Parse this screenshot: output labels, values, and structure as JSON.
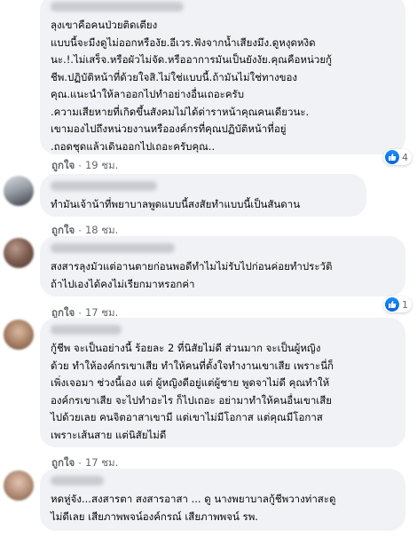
{
  "like_label": "ถูกใจ",
  "dot": "·",
  "comments": [
    {
      "text": "ลุงเขาคือคนป่วยติดเตียง\nแบบนี้จะมีงดูไม่ออกหรืองัย.อีเวร.ฟังจากน้ำเสียงมึง.ดูหงุดหงิด\nนะ.!.ไม่เสร็จ.หรือผัวไม่จัด.หรืออาการมันเป็นยังงัย.คุณคือหน่วยกู้\nชีพ.ปฏิบัติหน้าที่ด้วยใจสิ.ไม่ใช่แบบนี้.ถ้ามันไม่ใช่ทางของ\nคุณ.แนะนำให้ลาออกไปทำอย่างอื่นเถอะครับ\n.ความเสียหายที่เกิดขึ้นสังคมไม่ได้ด่าราหน้าคุณคนเดียวนะ.\nเขามองไปถึงหน่วยงานหรือองค์กรที่คุณปฏิบัติหน้าที่อยู่\n.ถอดชุดแล้วเดินออกไปเถอะครับคุณ..",
      "time": "19 ชม.",
      "reactions": "4"
    },
    {
      "text": "ทำมันเจ้าน้าที่พยาบาลพูดแบบนี้สงสัยทำแบบนี้เป็นสันดาน",
      "time": "18 ชม.",
      "reactions": ""
    },
    {
      "text": "สงสารลุงมัวแต่อานตายก่อนพอดีทำไมไม่รับไปก่อนค่อยทำประวัติ\nถ้าไปเองได้คงไม่เรียกมาหรอกค่า",
      "time": "17 ชม.",
      "reactions": "1"
    },
    {
      "text": "กู้ชีพ จะเป็นอย่างนี้ ร้อยละ 2 ที่นิสัยไม่ดี ส่วนมาก จะเป็นผู้หญิง\nด้วย ทำให้องค์กรเขาเสีย ทำให้คนที่ตั้งใจทำงานเขาเสีย เพราะนี่ก็\nเพิ่งเจอมา ช่วงนี้เอง แต่ ผู้หญิงดีอยู่แต่ผู้ชาย พูดจาไม่ดี คุณทำให้\nองค์กรเขาเสีย จะไปทำอะไร ก็ไปเถอะ อย่ามาทำให้คนอื่นเขาเสีย\nไปด้วยเลย คนจิตอาสาเขามี แต่เขาไม่มีโอกาส แต่คุณมีโอกาส\nเพราะเส้นสาย แต่นิสัยไม่ดี",
      "time": "17 ชม.",
      "reactions": ""
    },
    {
      "text": "หดหู่จัง...สงสารตา สงสารอาสา ... ดู นางพยาบาลกู้ชีพวางท่าสะดู\nไม่ดีเลย เสียภาพพจน์องค์กรณ์ เสียภาพพจน์ รพ.",
      "time": "",
      "reactions": ""
    }
  ],
  "colors": {
    "like_blue": "#1877f2",
    "bubble": "#f0f2f5",
    "meta": "#65676b"
  },
  "icons": {
    "reaction": "thumbs-up-icon"
  }
}
